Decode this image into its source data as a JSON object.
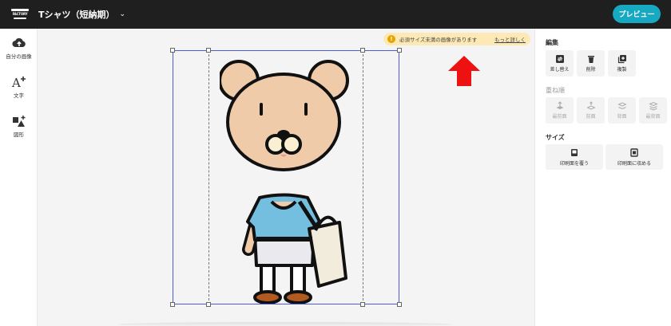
{
  "header": {
    "logo_text": "FACTORY",
    "title": "Tシャツ（短納期）",
    "preview_label": "プレビュー"
  },
  "left_tools": [
    {
      "label": "自分の画像",
      "icon": "cloud-upload-icon"
    },
    {
      "label": "文字",
      "icon": "text-add-icon"
    },
    {
      "label": "図形",
      "icon": "shapes-add-icon"
    }
  ],
  "canvas": {
    "notice_text": "必須サイズ未満の画像があります",
    "notice_link": "もっと詳しく"
  },
  "right_panel": {
    "edit_title": "編集",
    "edit_buttons": [
      "差し替え",
      "削除",
      "複製"
    ],
    "order_title": "重ね順",
    "order_buttons": [
      "最前面",
      "前面",
      "背面",
      "最背面"
    ],
    "size_title": "サイズ",
    "size_buttons": [
      "印刷面を覆う",
      "印刷面に収める"
    ]
  },
  "colors": {
    "topbar": "#1f1f1f",
    "accent": "#17a9c1",
    "notice_bg": "#fde9b5",
    "selection": "#4a5cd6",
    "arrow": "#ee1111",
    "bear_fur": "#efcbaa",
    "bear_shirt": "#74bfdf"
  }
}
